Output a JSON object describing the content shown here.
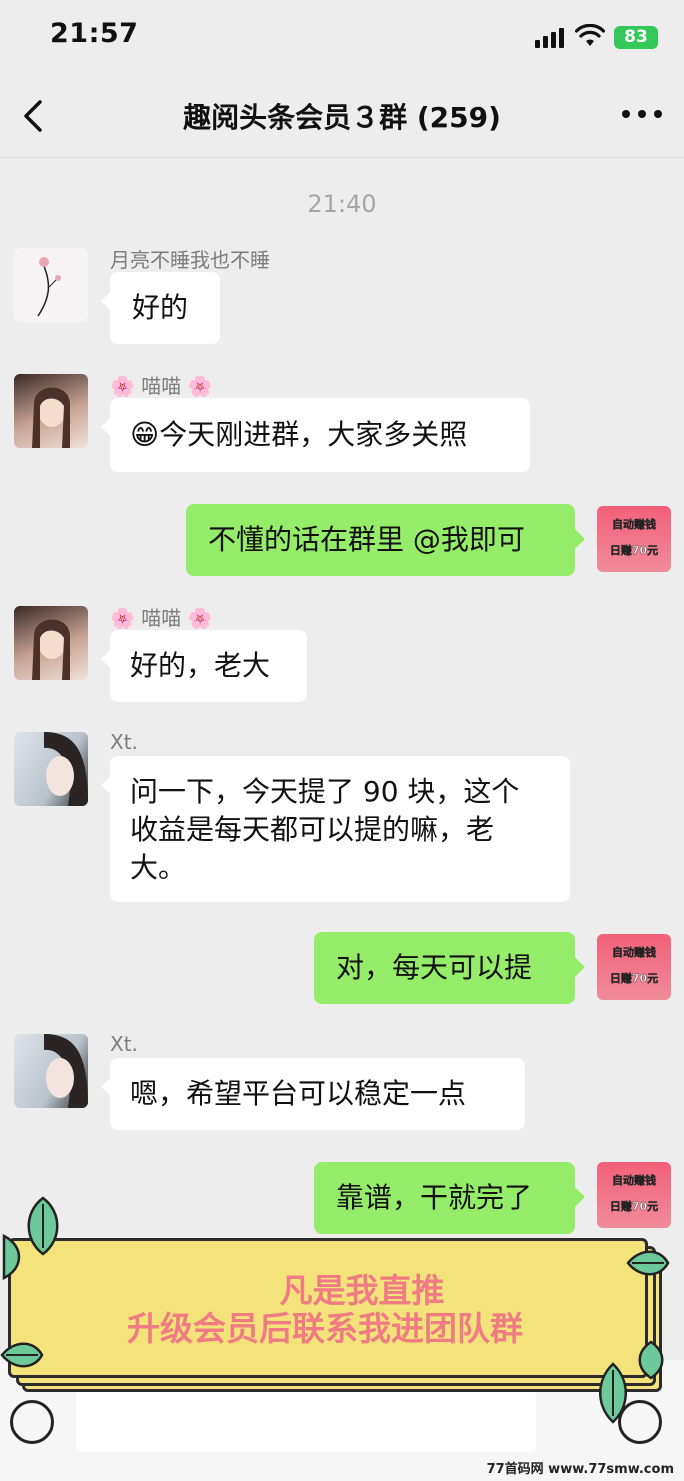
{
  "status_bar": {
    "time": "21:57",
    "battery": "83"
  },
  "header": {
    "title": "趣阅头条会员３群 (259)"
  },
  "chat": {
    "timestamp": "21:40",
    "messages": [
      {
        "sender": "月亮不睡我也不睡",
        "text": "好的"
      },
      {
        "sender": "🌸 喵喵 🌸",
        "text": "😁今天刚进群，大家多关照"
      },
      {
        "text": "不懂的话在群里 @我即可"
      },
      {
        "sender": "🌸 喵喵 🌸",
        "text": "好的，老大"
      },
      {
        "sender": "Xt.",
        "lines": [
          "问一下，今天提了 90 块，这个",
          "收益是每天都可以提的嘛，老",
          "大。"
        ]
      },
      {
        "text": "对，每天可以提"
      },
      {
        "sender": "Xt.",
        "text": "嗯，希望平台可以稳定一点"
      },
      {
        "text": "靠谱，干就完了"
      }
    ],
    "self_avatar": {
      "line1": "自动赚钱",
      "line2": "日赚70元"
    }
  },
  "banner": {
    "line1": "凡是我直推",
    "line2": "升级会员后联系我进团队群"
  },
  "watermark": "77首码网 www.77smw.com",
  "colors": {
    "bubble_out": "#95ec69",
    "bubble_in": "#ffffff",
    "background": "#ededed",
    "banner_fill": "#f4e27a",
    "banner_text": "#ef7c83"
  }
}
